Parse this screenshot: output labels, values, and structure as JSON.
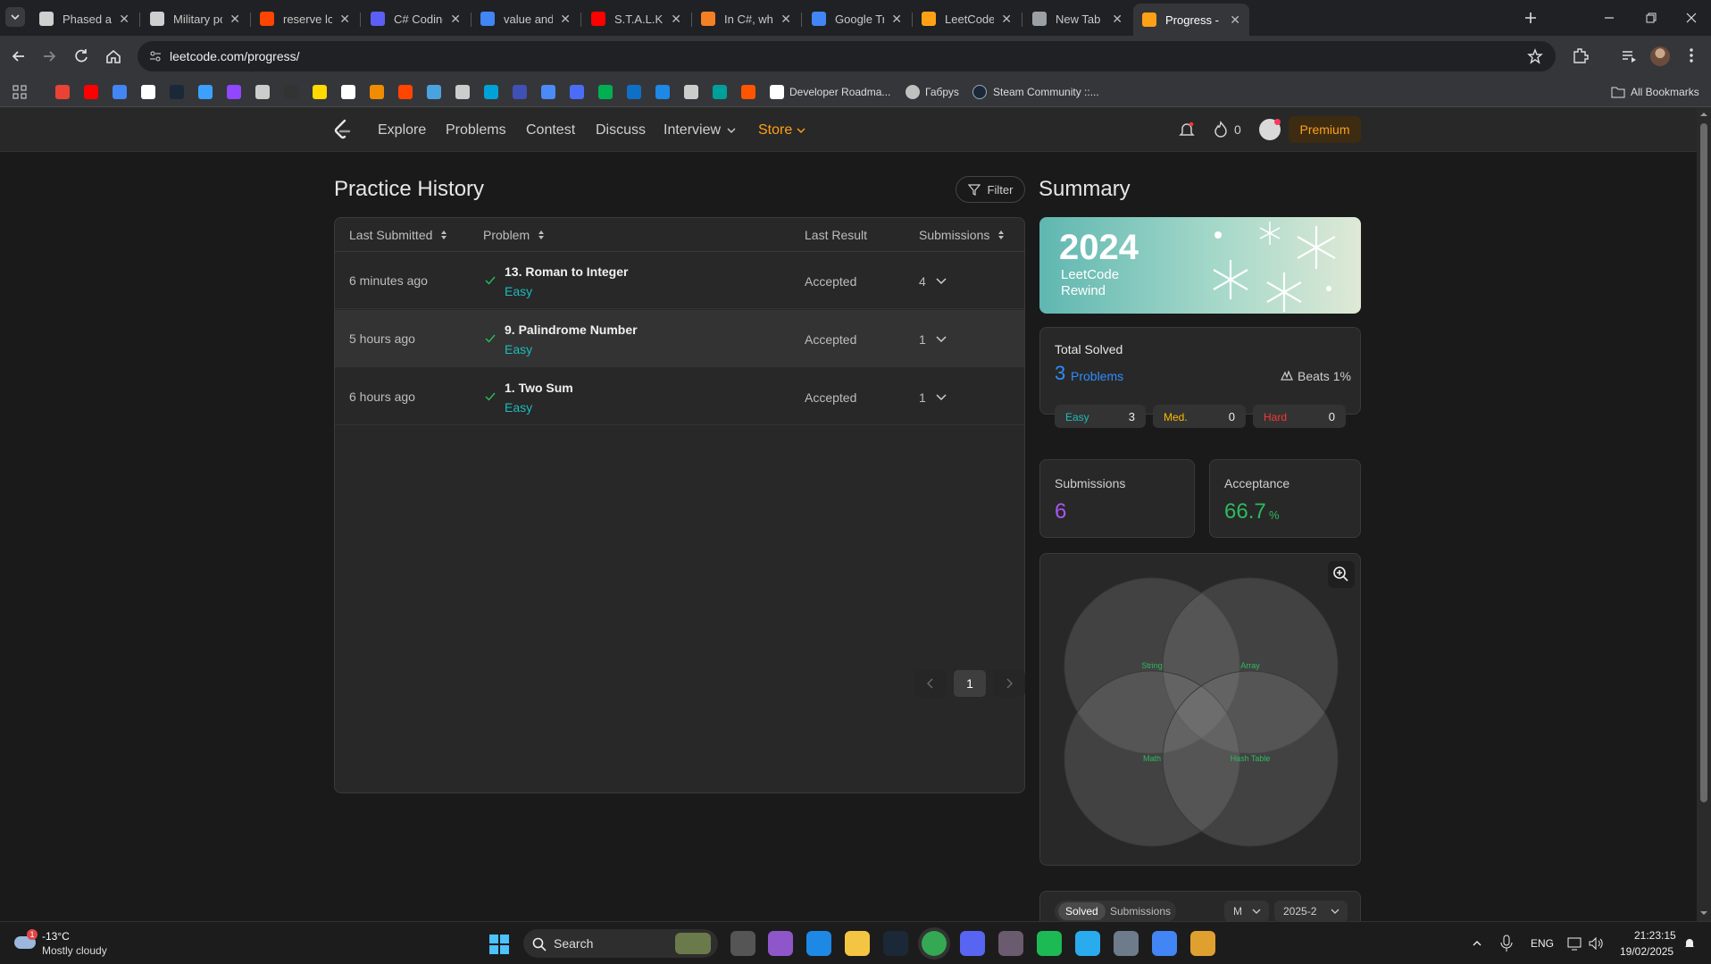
{
  "browser": {
    "tabs": [
      {
        "title": "Phased array el",
        "color": "#cfcfcf"
      },
      {
        "title": "Military power",
        "color": "#cfcfcf"
      },
      {
        "title": "reserve loot is",
        "color": "#ff4500"
      },
      {
        "title": "C# Coding guic",
        "color": "#5c5ff5"
      },
      {
        "title": "value and refer",
        "color": "#4285f4"
      },
      {
        "title": "S.T.A.L.K.E.R.: C",
        "color": "#ff0000"
      },
      {
        "title": "In C#, why is St",
        "color": "#f48024"
      },
      {
        "title": "Google Transla",
        "color": "#4285f4"
      },
      {
        "title": "LeetCode - The",
        "color": "#ffa116"
      },
      {
        "title": "New Tab",
        "color": "#9aa0a6"
      },
      {
        "title": "Progress - Leet",
        "color": "#ffa116"
      }
    ],
    "url": "leetcode.com/progress/",
    "bookmarks": {
      "developer_roadmaps": "Developer Roadma...",
      "habr": "Габруs",
      "steam_community": "Steam Community ::...",
      "all_bookmarks": "All Bookmarks"
    }
  },
  "nav": {
    "explore": "Explore",
    "problems": "Problems",
    "contest": "Contest",
    "discuss": "Discuss",
    "interview": "Interview",
    "store": "Store",
    "streak_count": "0",
    "premium": "Premium"
  },
  "history": {
    "title": "Practice History",
    "filter_label": "Filter",
    "columns": {
      "last_submitted": "Last Submitted",
      "problem": "Problem",
      "last_result": "Last Result",
      "submissions": "Submissions"
    },
    "rows": [
      {
        "time": "6 minutes ago",
        "problem": "13. Roman to Integer",
        "difficulty": "Easy",
        "result": "Accepted",
        "submissions": "4"
      },
      {
        "time": "5 hours ago",
        "problem": "9. Palindrome Number",
        "difficulty": "Easy",
        "result": "Accepted",
        "submissions": "1"
      },
      {
        "time": "6 hours ago",
        "problem": "1. Two Sum",
        "difficulty": "Easy",
        "result": "Accepted",
        "submissions": "1"
      }
    ],
    "page": "1"
  },
  "summary": {
    "title": "Summary",
    "banner": {
      "year": "2024",
      "line1": "LeetCode",
      "line2": "Rewind"
    },
    "total_solved_label": "Total Solved",
    "solved_count": "3",
    "solved_unit": "Problems",
    "beats": "Beats 1%",
    "easy_label": "Easy",
    "easy_count": "3",
    "med_label": "Med.",
    "med_count": "0",
    "hard_label": "Hard",
    "hard_count": "0",
    "submissions_label": "Submissions",
    "submissions_value": "6",
    "acceptance_label": "Acceptance",
    "acceptance_value": "66.7",
    "acceptance_unit": "%",
    "venn_labels": [
      "String",
      "Array",
      "Math",
      "Hash Table"
    ],
    "toggle_solved": "Solved",
    "toggle_submissions": "Submissions",
    "period_select": "M",
    "month_select": "2025-2"
  },
  "taskbar": {
    "temperature": "-13°C",
    "weather": "Mostly cloudy",
    "weather_badge": "1",
    "search": "Search",
    "language": "ENG",
    "time": "21:23:15",
    "date": "19/02/2025"
  },
  "colors": {
    "accent_orange": "#ffa116",
    "easy": "#1cbbba",
    "medium": "#ffb800",
    "hard": "#f63737",
    "accepted_green": "#2cbb5d",
    "link_blue": "#2f8cff",
    "purple": "#a855f7"
  }
}
